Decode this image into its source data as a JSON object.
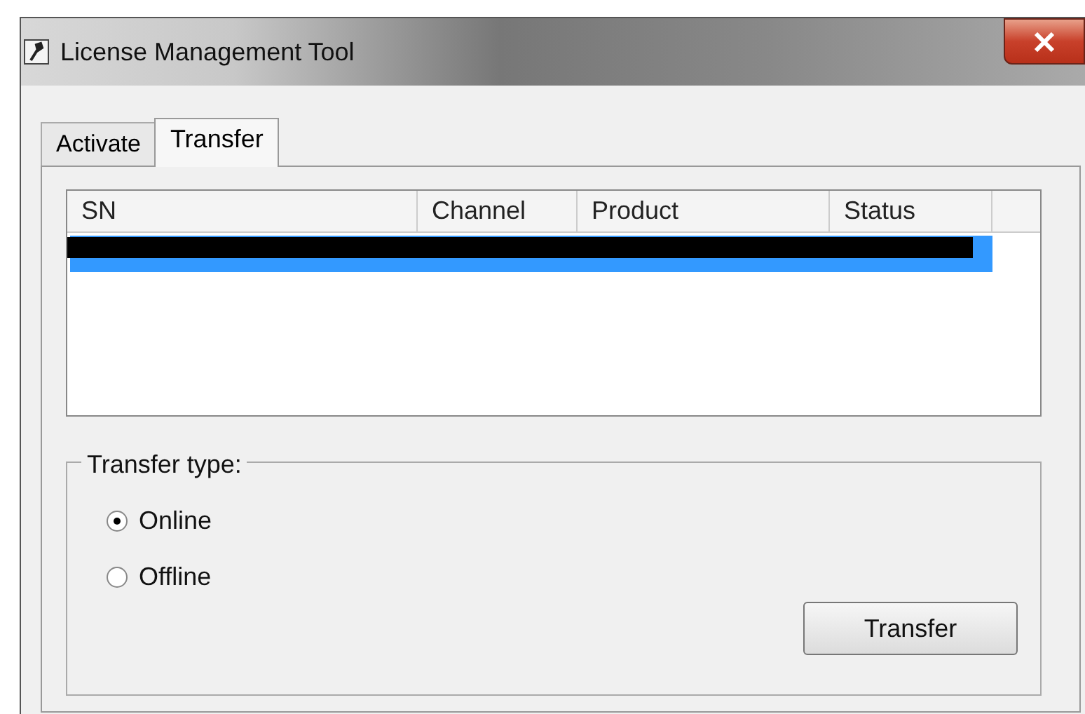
{
  "window": {
    "title": "License Management Tool"
  },
  "tabs": [
    {
      "label": "Activate",
      "selected": false
    },
    {
      "label": "Transfer",
      "selected": true
    }
  ],
  "table": {
    "columns": [
      "SN",
      "Channel",
      "Product",
      "Status"
    ],
    "rows": [
      {
        "selected": true,
        "redacted": true
      }
    ]
  },
  "transfer_type": {
    "label": "Transfer type:",
    "options": [
      {
        "label": "Online",
        "selected": true
      },
      {
        "label": "Offline",
        "selected": false
      }
    ]
  },
  "buttons": [
    "Transfer"
  ]
}
